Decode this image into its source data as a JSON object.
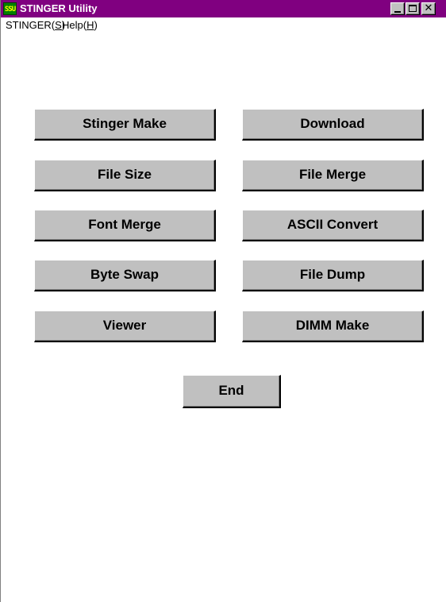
{
  "window": {
    "title": "STINGER Utility",
    "icon_label": "SSU",
    "title_bar_color": "#800080"
  },
  "menu": {
    "items": [
      {
        "prefix": "STINGER(",
        "accel": "S",
        "suffix": ")"
      },
      {
        "prefix": "Help(",
        "accel": "H",
        "suffix": ")"
      }
    ]
  },
  "buttons": {
    "stinger_make": "Stinger Make",
    "download": "Download",
    "file_size": "File Size",
    "file_merge": "File Merge",
    "font_merge": "Font Merge",
    "ascii_convert": "ASCII Convert",
    "byte_swap": "Byte Swap",
    "file_dump": "File Dump",
    "viewer": "Viewer",
    "dimm_make": "DIMM Make",
    "end": "End"
  }
}
